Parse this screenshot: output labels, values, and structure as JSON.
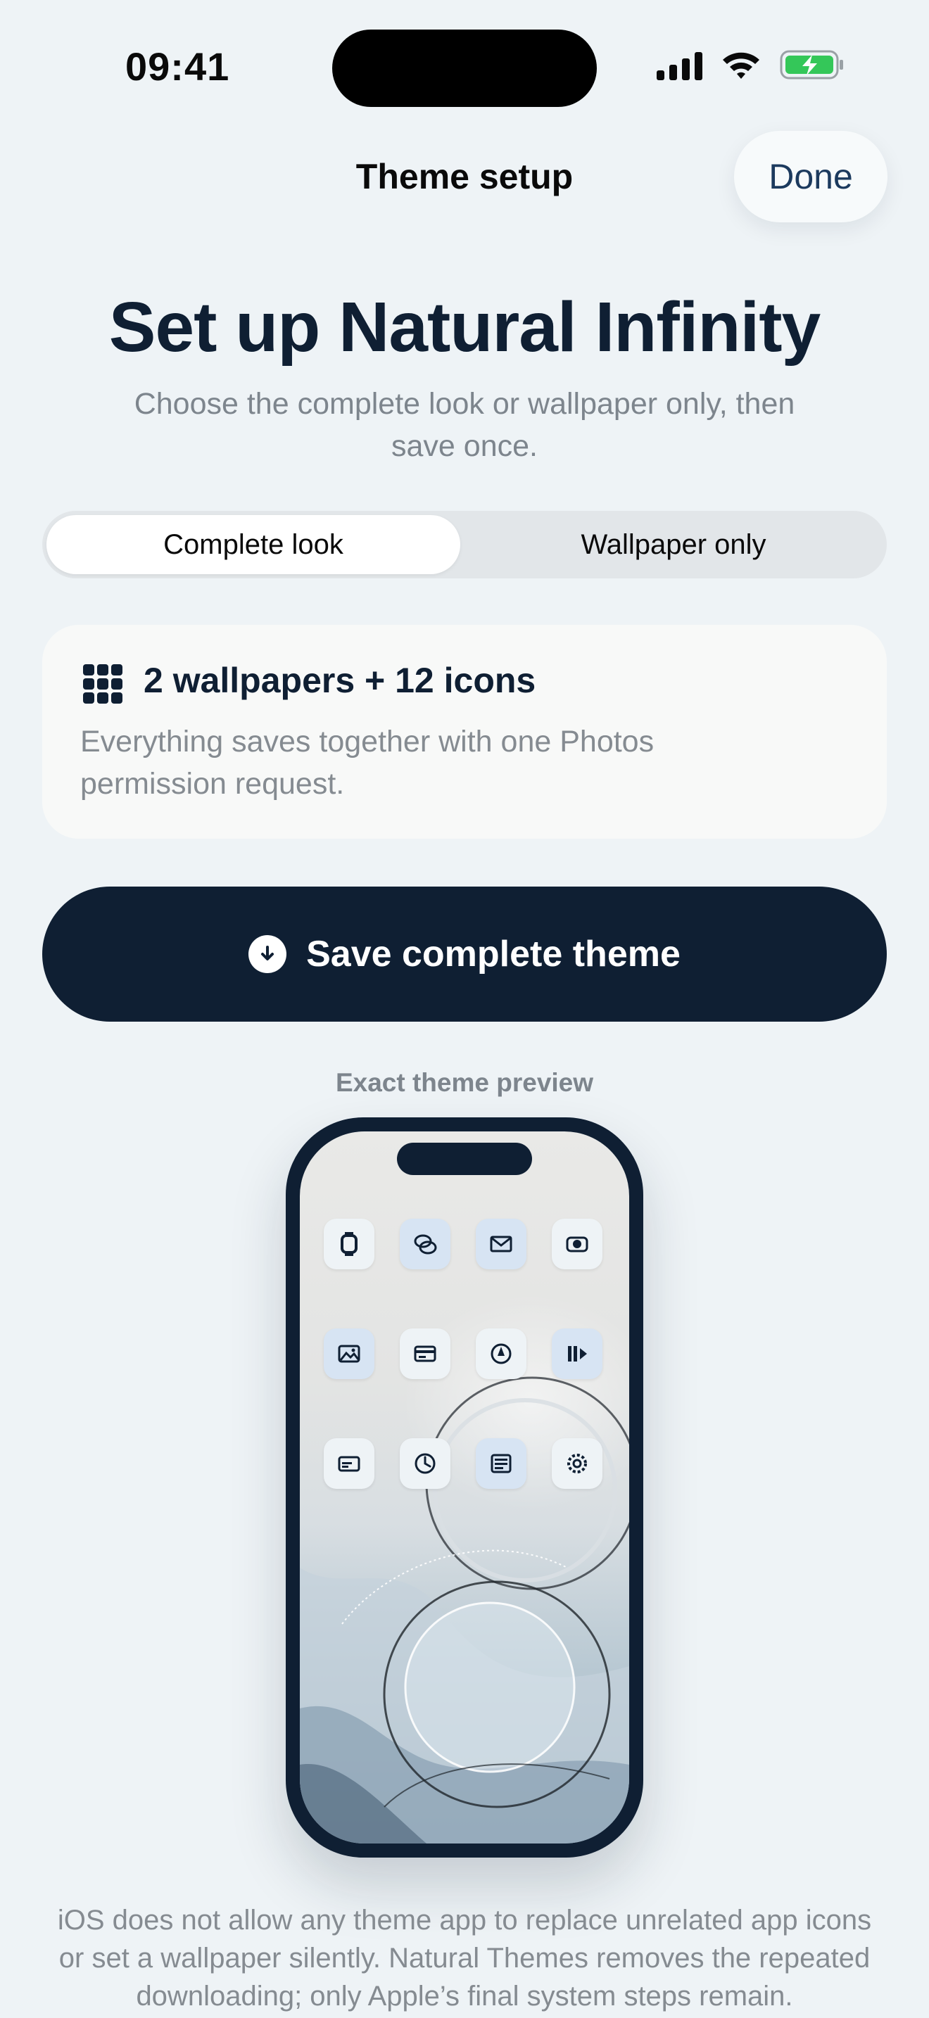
{
  "status_bar": {
    "time": "09:41",
    "icons": [
      "cellular-signal-icon",
      "wifi-icon",
      "battery-charging-icon"
    ]
  },
  "nav": {
    "title": "Theme setup",
    "done_label": "Done"
  },
  "header": {
    "title": "Set up Natural Infinity",
    "subtitle": "Choose the complete look or wallpaper only, then save once."
  },
  "segmented_control": {
    "options": [
      "Complete look",
      "Wallpaper only"
    ],
    "selected": "Complete look"
  },
  "info_card": {
    "icon": "grid-icon",
    "title": "2 wallpapers + 12 icons",
    "text": "Everything saves together with one Photos permission request."
  },
  "primary_action": {
    "icon": "download-icon",
    "label": "Save complete theme"
  },
  "preview": {
    "label": "Exact theme preview",
    "app_icons": [
      "watch-icon",
      "chat-bubbles-icon",
      "mail-icon",
      "camera-icon",
      "photos-icon",
      "wallet-icon",
      "compass-icon",
      "podcasts-icon",
      "card-icon",
      "clock-icon",
      "news-icon",
      "settings-icon"
    ]
  },
  "footer": {
    "note": "iOS does not allow any theme app to replace unrelated app icons or set a wallpaper silently. Natural Themes removes the repeated downloading; only Apple’s final system steps remain."
  },
  "colors": {
    "background": "#eef3f6",
    "primary": "#0f1f33",
    "secondary_text": "#7d858d",
    "battery_green": "#34c759"
  }
}
